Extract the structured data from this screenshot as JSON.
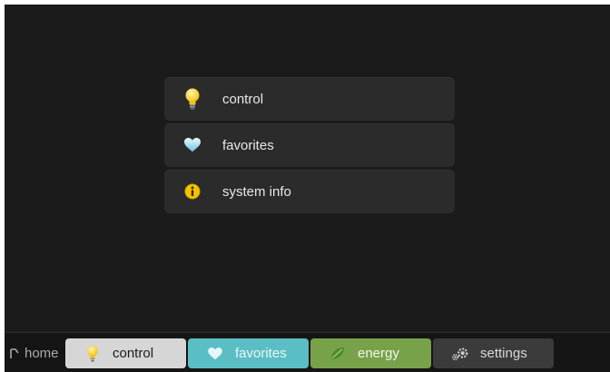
{
  "menu": {
    "items": [
      {
        "label": "control",
        "icon": "lightbulb-icon"
      },
      {
        "label": "favorites",
        "icon": "heart-icon"
      },
      {
        "label": "system info",
        "icon": "info-icon"
      }
    ]
  },
  "taskbar": {
    "home_label": "home",
    "tabs": [
      {
        "label": "control",
        "icon": "lightbulb-icon",
        "color": "#d6d6d6"
      },
      {
        "label": "favorites",
        "icon": "heart-icon",
        "color": "#5bbec4"
      },
      {
        "label": "energy",
        "icon": "leaf-icon",
        "color": "#77a24a"
      },
      {
        "label": "settings",
        "icon": "gears-icon",
        "color": "#3b3b3b"
      }
    ]
  }
}
